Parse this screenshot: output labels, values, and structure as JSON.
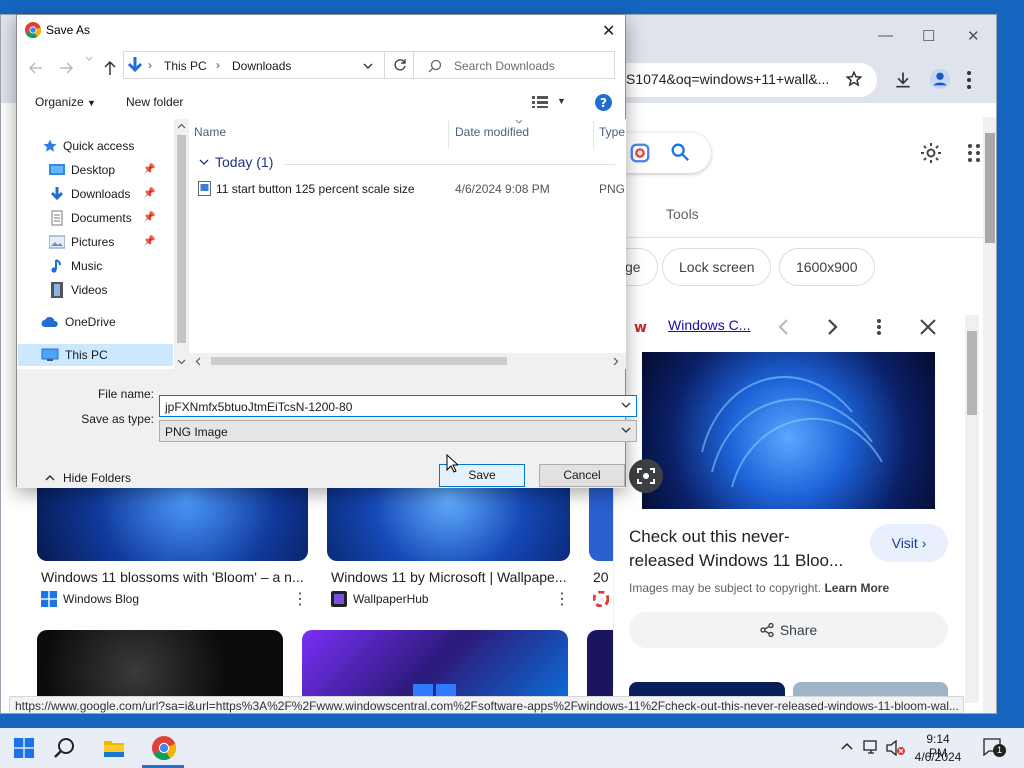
{
  "dialog": {
    "title": "Save As",
    "breadcrumb": [
      "This PC",
      "Downloads"
    ],
    "search_placeholder": "Search Downloads",
    "organize_label": "Organize",
    "new_folder_label": "New folder",
    "nav_items": [
      {
        "label": "Quick access",
        "icon": "star-icon"
      },
      {
        "label": "Desktop",
        "icon": "desktop-folder-icon",
        "pinned": true
      },
      {
        "label": "Downloads",
        "icon": "download-arrow-icon",
        "pinned": true
      },
      {
        "label": "Documents",
        "icon": "documents-folder-icon",
        "pinned": true
      },
      {
        "label": "Pictures",
        "icon": "pictures-folder-icon",
        "pinned": true
      },
      {
        "label": "Music",
        "icon": "music-note-icon"
      },
      {
        "label": "Videos",
        "icon": "film-icon"
      },
      {
        "label": "OneDrive",
        "icon": "cloud-icon"
      },
      {
        "label": "This PC",
        "icon": "monitor-icon",
        "selected": true
      }
    ],
    "columns": [
      "Name",
      "Date modified",
      "Type"
    ],
    "group_label": "Today (1)",
    "files": [
      {
        "name": "11 start button 125 percent scale size",
        "date": "4/6/2024 9:08 PM",
        "type": "PNG"
      }
    ],
    "file_name_label": "File name:",
    "file_name_value": "jpFXNmfx5btuoJtmEiTcsN-1200-80",
    "save_type_label": "Save as type:",
    "save_type_value": "PNG Image",
    "hide_folders_label": "Hide Folders",
    "save_label": "Save",
    "cancel_label": "Cancel"
  },
  "chrome": {
    "url_fragment": "S1074&oq=windows+11+wall&...",
    "tools_label": "Tools",
    "chips": [
      "ge",
      "Lock screen",
      "1600x900"
    ],
    "panel": {
      "source": "Windows C...",
      "title": "Check out this never-released Windows 11 Bloo...",
      "visit_label": "Visit",
      "copyright_text": "Images may be subject to copyright.",
      "learn_more": "Learn More",
      "share_label": "Share"
    },
    "results": [
      {
        "title": "Windows 11 blossoms with 'Bloom' – a n...",
        "source": "Windows Blog"
      },
      {
        "title": "Windows 11 by Microsoft | Wallpape...",
        "source": "WallpaperHub"
      },
      {
        "title": "20",
        "source": ""
      }
    ],
    "status_url": "https://www.google.com/url?sa=i&url=https%3A%2F%2Fwww.windowscentral.com%2Fsoftware-apps%2Fwindows-11%2Fcheck-out-this-never-released-windows-11-bloom-wal..."
  },
  "taskbar": {
    "time": "9:14 PM",
    "date": "4/6/2024",
    "notification_count": "1"
  },
  "colors": {
    "desktop": "#1565c0",
    "accent": "#0078d7",
    "selection": "#cce8ff"
  }
}
